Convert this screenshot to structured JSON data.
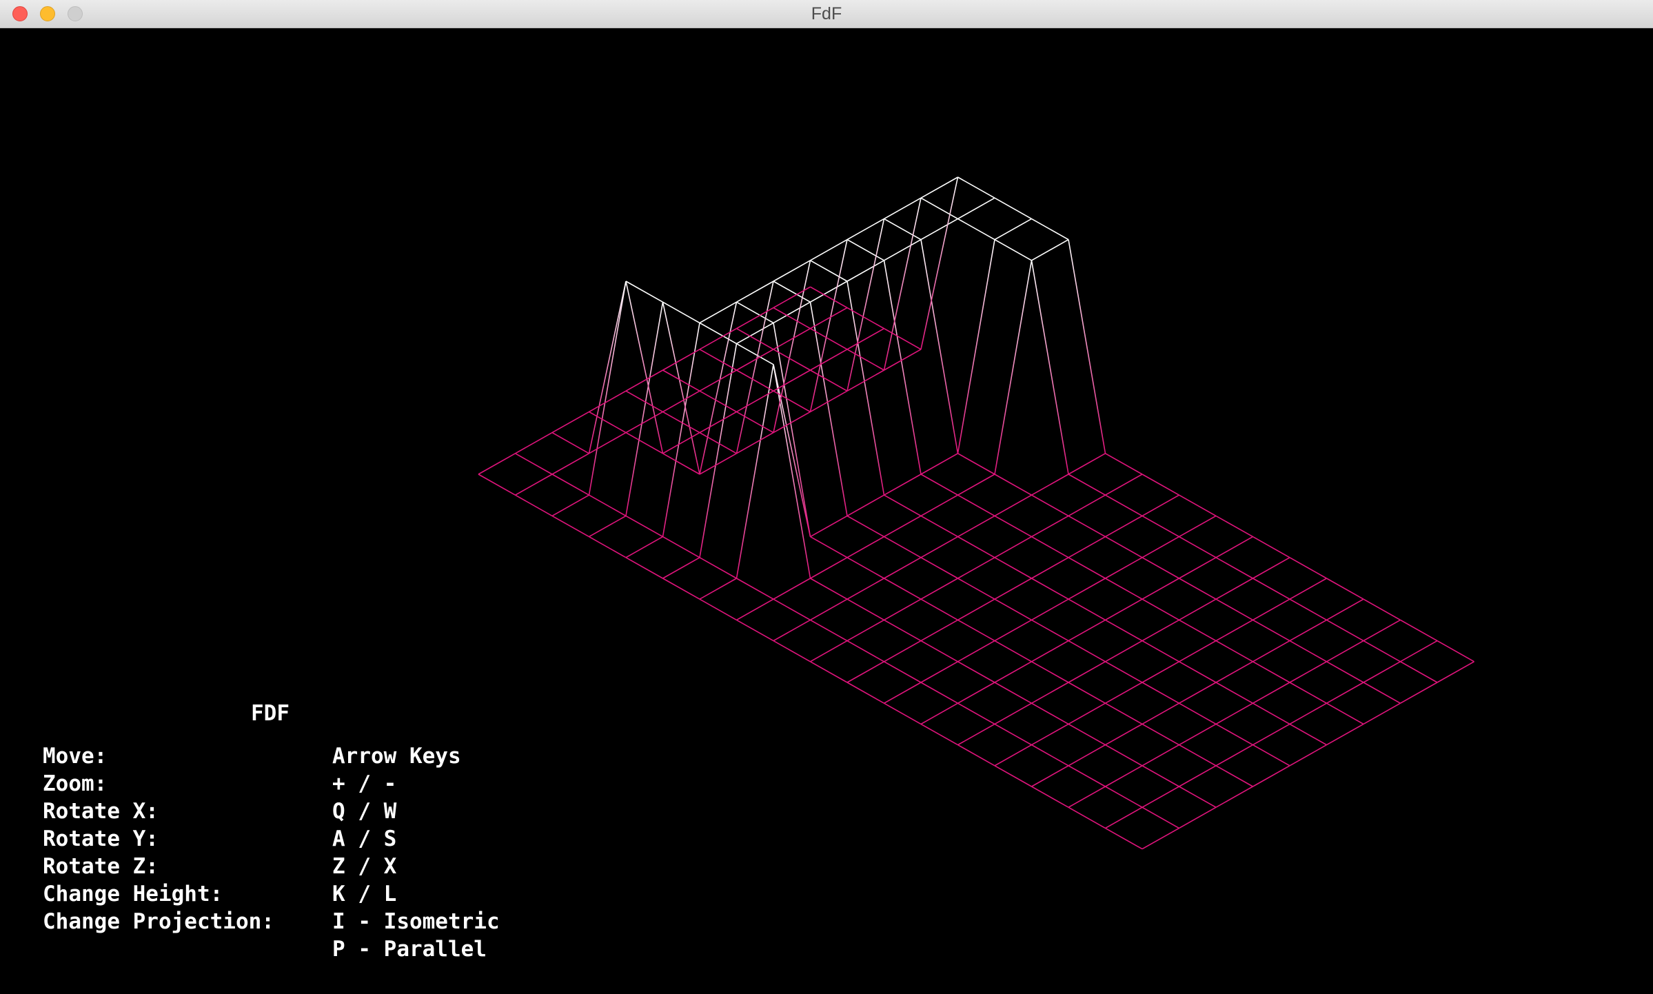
{
  "window": {
    "title": "FdF"
  },
  "hud": {
    "title": "FDF",
    "controls": [
      {
        "label": "Move:",
        "keys": "Arrow Keys"
      },
      {
        "label": "Zoom:",
        "keys": "+ / -"
      },
      {
        "label": "Rotate X:",
        "keys": "Q / W"
      },
      {
        "label": "Rotate Y:",
        "keys": "A / S"
      },
      {
        "label": "Rotate Z:",
        "keys": "Z / X"
      },
      {
        "label": "Change Height:",
        "keys": "K / L"
      },
      {
        "label": "Change Projection:",
        "keys": "I - Isometric"
      },
      {
        "label": "",
        "keys": "P - Parallel"
      }
    ]
  },
  "map": {
    "projection": "isometric",
    "colors": {
      "low": "#e0147c",
      "high": "#ffffff",
      "background": "#000000"
    },
    "heights": [
      [
        0,
        0,
        0,
        0,
        0,
        0,
        0,
        0,
        0,
        0,
        0,
        0,
        0,
        0,
        0,
        0,
        0,
        0,
        0
      ],
      [
        0,
        0,
        0,
        0,
        0,
        0,
        0,
        0,
        0,
        0,
        0,
        0,
        0,
        0,
        0,
        0,
        0,
        0,
        0
      ],
      [
        0,
        0,
        10,
        10,
        10,
        10,
        10,
        0,
        0,
        0,
        0,
        0,
        0,
        0,
        0,
        0,
        0,
        0,
        0
      ],
      [
        0,
        0,
        0,
        0,
        10,
        10,
        0,
        0,
        0,
        0,
        0,
        0,
        0,
        0,
        0,
        0,
        0,
        0,
        0
      ],
      [
        0,
        0,
        0,
        0,
        10,
        10,
        0,
        0,
        0,
        0,
        0,
        0,
        0,
        0,
        0,
        0,
        0,
        0,
        0
      ],
      [
        0,
        0,
        0,
        0,
        10,
        10,
        0,
        0,
        0,
        0,
        0,
        0,
        0,
        0,
        0,
        0,
        0,
        0,
        0
      ],
      [
        0,
        0,
        0,
        0,
        10,
        10,
        0,
        0,
        0,
        0,
        0,
        0,
        0,
        0,
        0,
        0,
        0,
        0,
        0
      ],
      [
        0,
        0,
        0,
        0,
        10,
        10,
        0,
        0,
        0,
        0,
        0,
        0,
        0,
        0,
        0,
        0,
        0,
        0,
        0
      ],
      [
        0,
        0,
        0,
        0,
        10,
        10,
        10,
        10,
        0,
        0,
        0,
        0,
        0,
        0,
        0,
        0,
        0,
        0,
        0
      ],
      [
        0,
        0,
        0,
        0,
        10,
        10,
        10,
        10,
        0,
        0,
        0,
        0,
        0,
        0,
        0,
        0,
        0,
        0,
        0
      ]
    ]
  }
}
